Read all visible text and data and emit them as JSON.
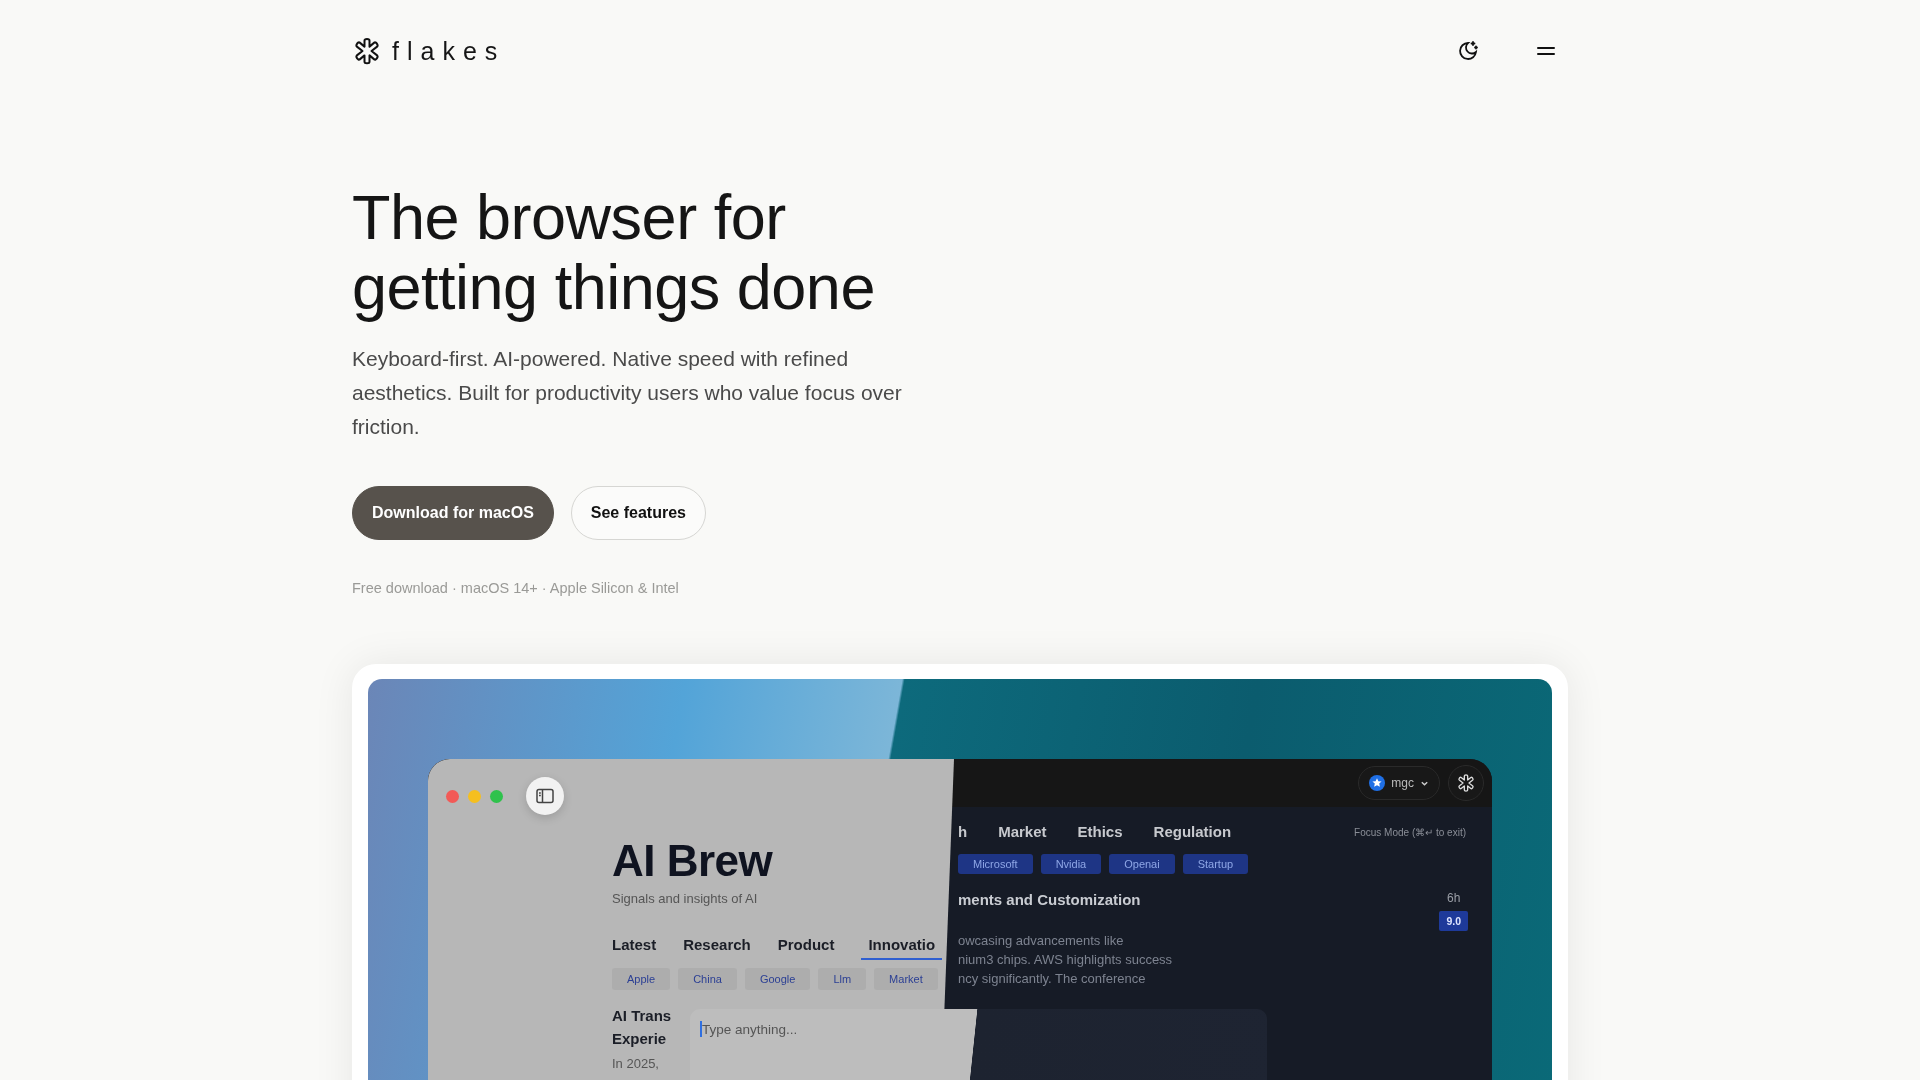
{
  "header": {
    "logo": "flakes"
  },
  "hero": {
    "title_lines": [
      "The browser for",
      "getting things done"
    ],
    "subtitle": "Keyboard-first. AI-powered. Native speed with refined aesthetics. Built for productivity users who value focus over friction.",
    "buttons": [
      {
        "label": "Download for macOS",
        "kind": "primary"
      },
      {
        "label": "See features",
        "kind": "secondary"
      }
    ],
    "note": "Free download · macOS 14+ · Apple Silicon & Intel"
  },
  "preview": {
    "light": {
      "title": "AI Brew",
      "subtitle": "Signals and insights of AI",
      "tabs": [
        {
          "label": "Latest",
          "selected": false
        },
        {
          "label": "Research",
          "selected": false
        },
        {
          "label": "Product",
          "selected": false
        },
        {
          "label": "Innovatio",
          "selected": true
        }
      ],
      "tags": [
        "Apple",
        "China",
        "Google",
        "Llm",
        "Market"
      ],
      "article": {
        "title_lines": [
          "AI Trans",
          "Experie"
        ],
        "excerpt": "In 2025,"
      }
    },
    "dark": {
      "account": "mgc",
      "focus_hint": "Focus Mode (⌘↵ to exit)",
      "tabs": [
        {
          "label": "h",
          "selected": false
        },
        {
          "label": "Market",
          "selected": false
        },
        {
          "label": "Ethics",
          "selected": false
        },
        {
          "label": "Regulation",
          "selected": false
        }
      ],
      "tags": [
        "Microsoft",
        "Nvidia",
        "Openai",
        "Startup"
      ],
      "article": {
        "title": "ments and Customization",
        "age": "6h",
        "score": "9.0",
        "lines": [
          "owcasing advancements like",
          "nium3 chips. AWS highlights success",
          "ncy significantly. The conference"
        ]
      }
    },
    "command_bar": {
      "placeholder": "Type anything..."
    }
  }
}
